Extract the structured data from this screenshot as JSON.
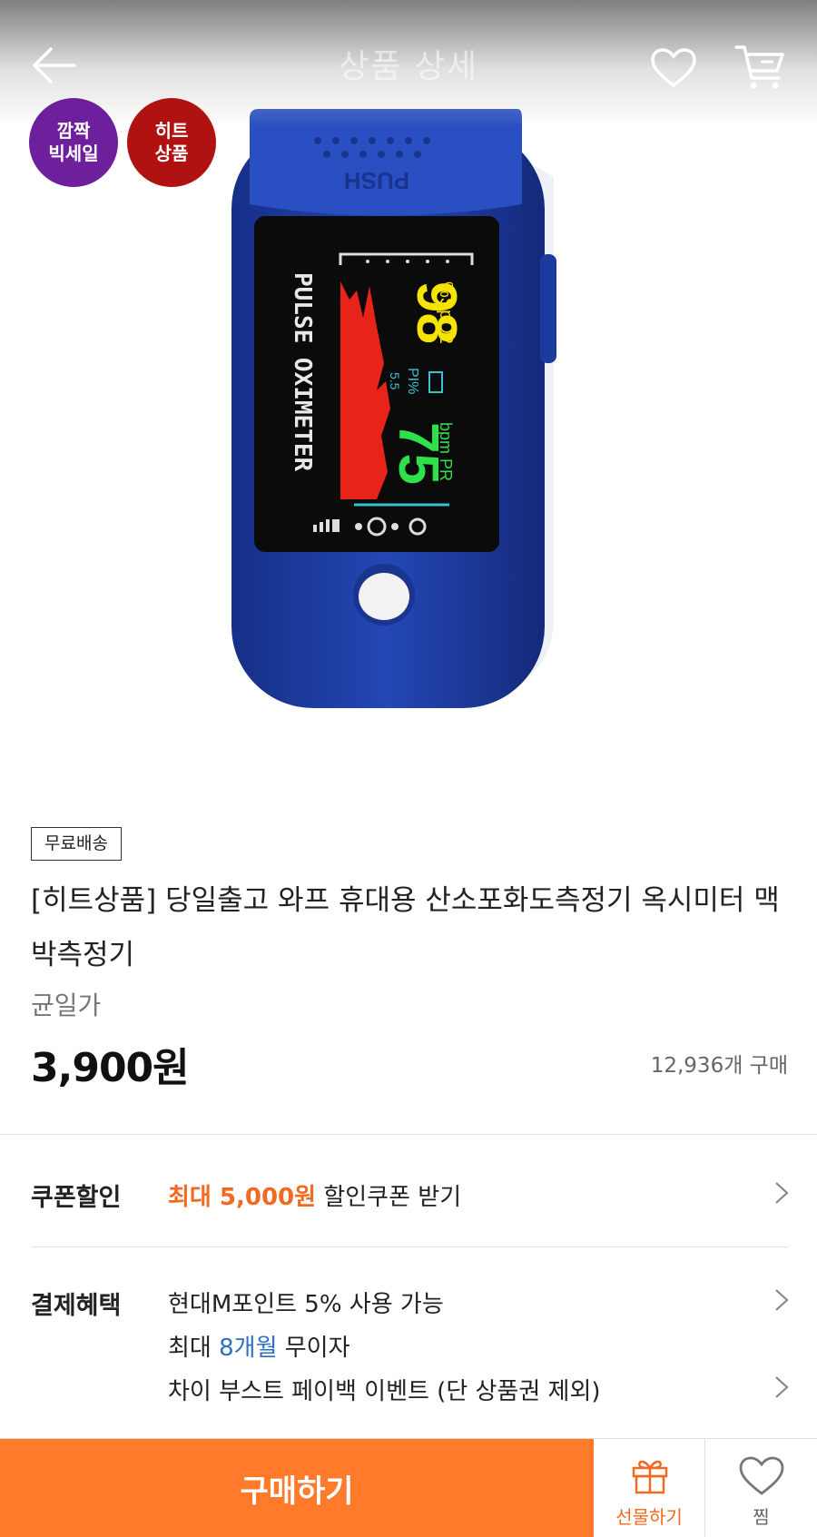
{
  "header": {
    "title": "상품 상세"
  },
  "badges": [
    {
      "text": "깜짝\n빅세일",
      "color": "#6e1f9c"
    },
    {
      "text": "히트\n상품",
      "color": "#b01212"
    }
  ],
  "product_image": {
    "push_label": "PUSH",
    "brand_text": "PULSE OXIMETER",
    "spo2_value": "98",
    "spo2_unit": "%SpO2",
    "pi_label": "PI%",
    "pi_value": "5.5",
    "pr_value": "75",
    "pr_unit": "bpm PR"
  },
  "product": {
    "shipping_tag": "무료배송",
    "title": "[히트상품] 당일출고 와프 휴대용 산소포화도측정기 옥시미터 맥박측정기",
    "price_label": "균일가",
    "price": "3,900원",
    "purchase_count": "12,936개 구매"
  },
  "coupon": {
    "label": "쿠폰할인",
    "highlight": "최대 5,000원",
    "text": "할인쿠폰 받기"
  },
  "payment": {
    "label": "결제혜택",
    "line1": "현대M포인트 5% 사용 가능",
    "line2_prefix": "최대",
    "line2_highlight": "8개월",
    "line2_suffix": "무이자",
    "line3": "차이 부스트 페이백 이벤트 (단 상품권 제외)"
  },
  "bottom_bar": {
    "buy_label": "구매하기",
    "gift_label": "선물하기",
    "zzim_label": "찜"
  },
  "colors": {
    "accent": "#ff7a2a",
    "price_highlight": "#f26a21",
    "link_blue": "#2d6fc2",
    "device_blue": "#1f3fa0"
  }
}
